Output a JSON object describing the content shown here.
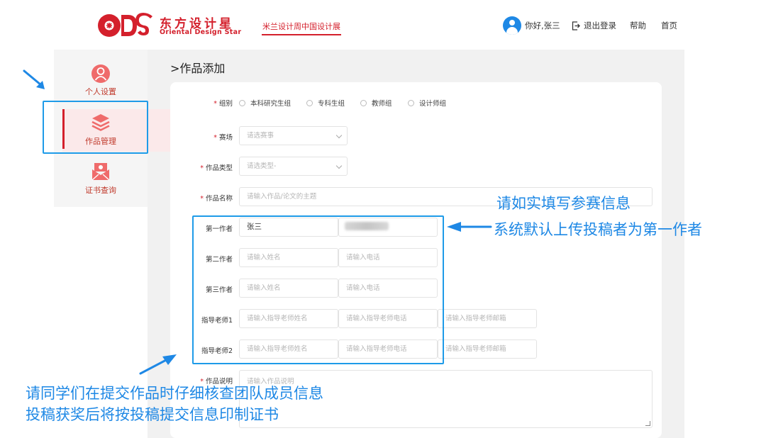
{
  "header": {
    "logo_text_cn": "东方设计星",
    "logo_text_en": "Oriental Design Star",
    "logo_mark": "ODS",
    "nav_link": "米兰设计周中国设计展",
    "user_greeting": "你好,张三",
    "logout_label": "退出登录",
    "help_label": "帮助",
    "home_label": "首页"
  },
  "sidebar": {
    "items": [
      {
        "label": "个人设置",
        "icon": "person-icon"
      },
      {
        "label": "作品管理",
        "icon": "layers-icon"
      },
      {
        "label": "证书查询",
        "icon": "certificate-icon"
      }
    ]
  },
  "page": {
    "title": ">作品添加"
  },
  "form": {
    "group": {
      "label": "组别",
      "options": [
        "本科研究生组",
        "专科生组",
        "教师组",
        "设计师组"
      ]
    },
    "venue": {
      "label": "赛场",
      "placeholder": "请选赛事"
    },
    "type": {
      "label": "作品类型",
      "placeholder": "请选类型-"
    },
    "name": {
      "label": "作品名称",
      "placeholder": "请输入作品/论文的主题"
    },
    "author1": {
      "label": "第一作者",
      "name_value": "张三"
    },
    "author2": {
      "label": "第二作者",
      "name_placeholder": "请输入姓名",
      "phone_placeholder": "请输入电话"
    },
    "author3": {
      "label": "第三作者",
      "name_placeholder": "请输入姓名",
      "phone_placeholder": "请输入电话"
    },
    "teacher1": {
      "label": "指导老师1",
      "name_placeholder": "请输入指导老师姓名",
      "phone_placeholder": "请输入指导老师电话",
      "email_placeholder": "请输入指导老师邮箱"
    },
    "teacher2": {
      "label": "指导老师2",
      "name_placeholder": "请输入指导老师姓名",
      "phone_placeholder": "请输入指导老师电话",
      "email_placeholder": "请输入指导老师邮箱"
    },
    "description": {
      "label": "作品说明",
      "placeholder": "请输入作品说明"
    }
  },
  "annotations": {
    "right_line1": "请如实填写参赛信息",
    "right_line2": "系统默认上传投稿者为第一作者",
    "bottom_line1": "请同学们在提交作品时仔细核查团队成员信息",
    "bottom_line2": "投稿获奖后将按投稿提交信息印制证书"
  },
  "colors": {
    "brand_red": "#d4202c",
    "annotation_blue": "#1e88e5",
    "avatar_blue": "#1e88e5"
  }
}
